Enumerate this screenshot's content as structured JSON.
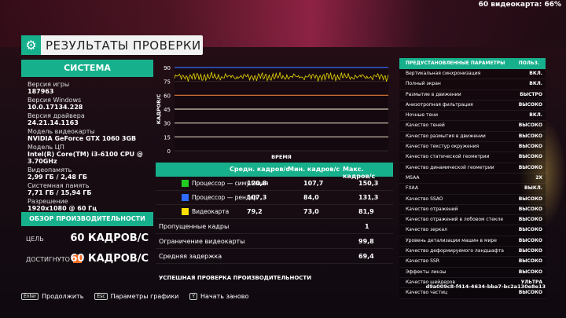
{
  "topbar": {
    "fps_label": "60 видеокарта: 66%"
  },
  "header": {
    "title": "РЕЗУЛЬТАТЫ ПРОВЕРКИ",
    "icon": "gear-icon"
  },
  "system": {
    "title": "СИСТЕМА",
    "items": [
      {
        "label": "Версия игры",
        "value": "187963"
      },
      {
        "label": "Версия Windows",
        "value": "10.0.17134.228"
      },
      {
        "label": "Версия драйвера",
        "value": "24.21.14.1163"
      },
      {
        "label": "Модель видеокарты",
        "value": "NVIDIA GeForce GTX 1060 3GB"
      },
      {
        "label": "Модель ЦП",
        "value": "Intel(R) Core(TM) i3-6100 CPU @ 3.70GHz"
      },
      {
        "label": "Видеопамять",
        "value": "2,99 ГБ / 2,48 ГБ"
      },
      {
        "label": "Системная память",
        "value": "7,71 ГБ / 15,94 ГБ"
      },
      {
        "label": "Разрешение",
        "value": "1920x1080 @ 60 Гц"
      }
    ]
  },
  "performance": {
    "title": "ОБЗОР ПРОИЗВОДИТЕЛЬНОСТИ",
    "target_label": "ЦЕЛЬ",
    "target_value": "60 КАДРОВ/С",
    "achieved_label": "ДОСТИГНУТО",
    "achieved_value": "60 КАДРОВ/С",
    "achieved_color": "#f26c21"
  },
  "chart_data": {
    "type": "line",
    "ylabel": "КАДРОВ/С",
    "xlabel": "ВРЕМЯ",
    "ylim": [
      0,
      90
    ],
    "yticks": [
      0,
      15,
      30,
      45,
      60,
      75,
      90
    ],
    "grid": true,
    "reference_lines": [
      {
        "value": 60,
        "color": "#e07a3a"
      },
      {
        "value": 45,
        "color": "#d8c9b8"
      },
      {
        "value": 30,
        "color": "#d8c9b8"
      },
      {
        "value": 15,
        "color": "#d8c9b8"
      }
    ],
    "series": [
      {
        "color": "#2f6bff",
        "approx_value": 90
      },
      {
        "color": "#e6d800",
        "approx_value": 80
      }
    ]
  },
  "table": {
    "headers": [
      "Средн. кадров/с",
      "Мин. кадров/с",
      "Макс. кадров/с"
    ],
    "rows": [
      {
        "label": "Процессор — симуляция",
        "color": "#22cc22",
        "avg": "120,8",
        "min": "107,7",
        "max": "150,3"
      },
      {
        "label": "Процессор — рендер",
        "color": "#2f6bff",
        "avg": "107,3",
        "min": "84,0",
        "max": "131,3"
      },
      {
        "label": "Видеокарта",
        "color": "#ffe000",
        "avg": "79,2",
        "min": "73,0",
        "max": "81,9"
      }
    ],
    "stats": [
      {
        "label": "Пропущенные кадры",
        "value": "1"
      },
      {
        "label": "Ограничение видеокарты",
        "value": "99,8"
      },
      {
        "label": "Средняя задержка",
        "value": "69,4"
      }
    ],
    "success": "УСПЕШНАЯ ПРОВЕРКА ПРОИЗВОДИТЕЛЬНОСТИ"
  },
  "params": {
    "title": "ПРЕДУСТАНОВЛЕННЫЕ ПАРАМЕТРЫ",
    "preset": "ПОЛЬЗ.",
    "rows": [
      {
        "label": "Вертикальная синхронизация",
        "value": "ВКЛ."
      },
      {
        "label": "Полный экран",
        "value": "ВКЛ."
      },
      {
        "label": "Размытие в движении",
        "value": "БЫСТРО"
      },
      {
        "label": "Анизотропная фильтрация",
        "value": "ВЫСОКО"
      },
      {
        "label": "Ночные тени",
        "value": "ВКЛ."
      },
      {
        "label": "Качество теней",
        "value": "ВЫСОКО"
      },
      {
        "label": "Качество размытия в движении",
        "value": "ВЫСОКО"
      },
      {
        "label": "Качество текстур окружения",
        "value": "ВЫСОКО"
      },
      {
        "label": "Качество статической геометрии",
        "value": "ВЫСОКО"
      },
      {
        "label": "Качество динамической геометрии",
        "value": "ВЫСОКО"
      },
      {
        "label": "MSAA",
        "value": "2X"
      },
      {
        "label": "FXAA",
        "value": "ВЫКЛ."
      },
      {
        "label": "Качество SSAO",
        "value": "ВЫСОКО"
      },
      {
        "label": "Качество отражений",
        "value": "ВЫСОКО"
      },
      {
        "label": "Качество отражений в лобовом стекле",
        "value": "ВЫСОКО"
      },
      {
        "label": "Качество зеркал",
        "value": "ВЫСОКО"
      },
      {
        "label": "Уровень детализации машин в мире",
        "value": "ВЫСОКО"
      },
      {
        "label": "Качество деформируемого ландшафта",
        "value": "ВЫСОКО"
      },
      {
        "label": "Качество SSR",
        "value": "ВЫСОКО"
      },
      {
        "label": "Эффекты линзы",
        "value": "ВЫСОКО"
      },
      {
        "label": "Качество шейдеров",
        "value": "УЛЬТРА"
      },
      {
        "label": "Качество частиц",
        "value": "ВЫСОКО"
      }
    ],
    "guid": "d9a009c8-f414-4634-bba7-bc2a130e8e13"
  },
  "footer": {
    "hints": [
      {
        "key": "Enter",
        "label": "Продолжить"
      },
      {
        "key": "Esc",
        "label": "Параметры графики"
      },
      {
        "key": "Y",
        "label": "Начать заново"
      }
    ]
  }
}
